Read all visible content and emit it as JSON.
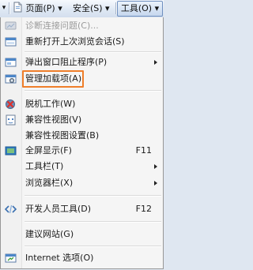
{
  "commandbar": {
    "overflow_arrow": "▾",
    "page_label": "页面(P) ▾",
    "safety_label": "安全(S) ▾",
    "tools_label": "工具(O) ▾"
  },
  "menu": {
    "items": [
      {
        "label": "诊断连接问题(C)...",
        "enabled": false,
        "icon": "diagnose-icon"
      },
      {
        "label": "重新打开上次浏览会话(S)",
        "icon": "reopen-session-icon"
      },
      {
        "label": "弹出窗口阻止程序(P)",
        "submenu": true,
        "icon": "popup-blocker-icon"
      },
      {
        "label": "管理加载项(A)",
        "icon": "manage-addons-icon",
        "highlighted": true
      },
      {
        "label": "脱机工作(W)",
        "icon": "work-offline-icon"
      },
      {
        "label": "兼容性视图(V)",
        "icon": "compatibility-view-icon"
      },
      {
        "label": "兼容性视图设置(B)"
      },
      {
        "label": "全屏显示(F)",
        "shortcut": "F11",
        "icon": "fullscreen-icon"
      },
      {
        "label": "工具栏(T)",
        "submenu": true
      },
      {
        "label": "浏览器栏(X)",
        "submenu": true
      },
      {
        "label": "开发人员工具(D)",
        "shortcut": "F12",
        "icon": "developer-tools-icon"
      },
      {
        "label": "建议网站(G)"
      },
      {
        "label": "Internet 选项(O)",
        "icon": "internet-options-icon"
      }
    ]
  },
  "colors": {
    "highlight_border": "#ef7e2a",
    "disabled_text": "#9a9a9a"
  }
}
